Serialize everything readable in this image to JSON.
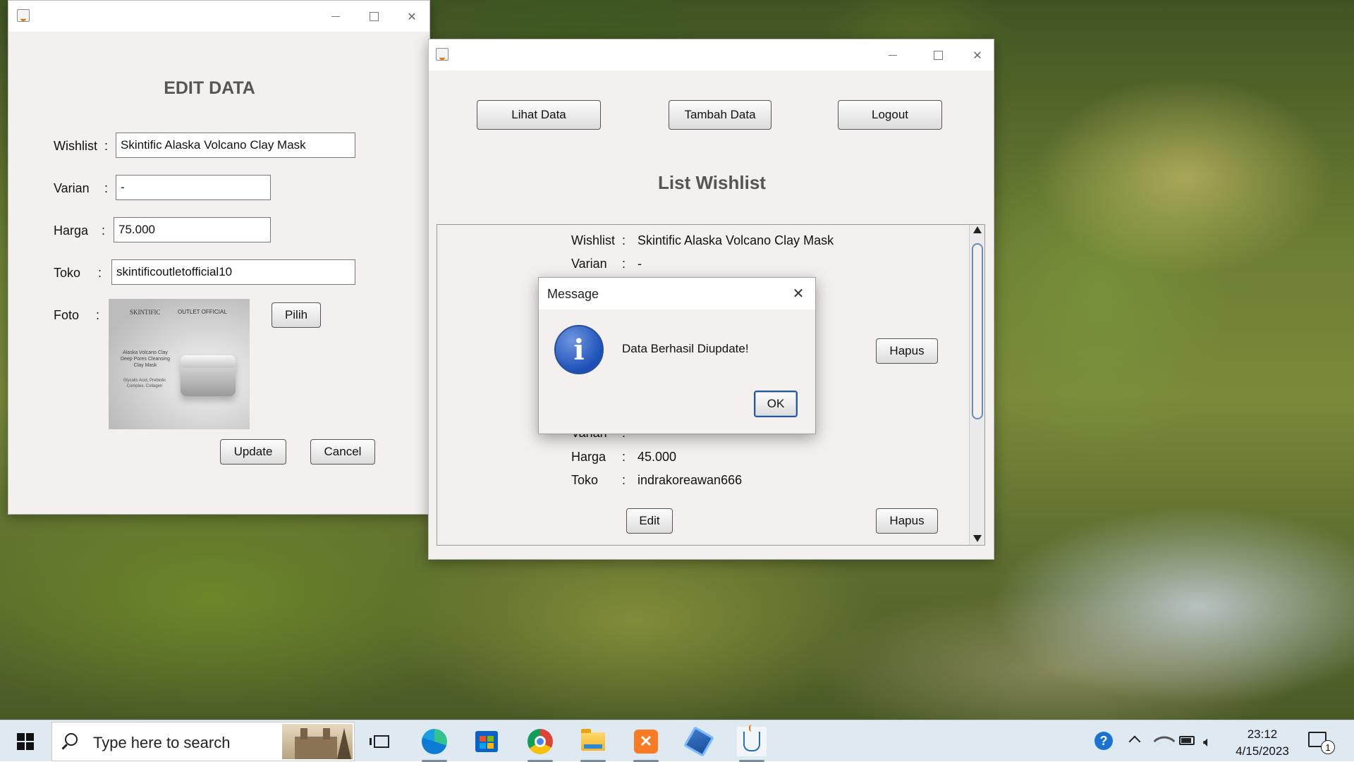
{
  "edit_window": {
    "heading": "EDIT DATA",
    "fields": [
      {
        "label": "Wishlist",
        "colon": ":",
        "value": "Skintific Alaska Volcano Clay Mask"
      },
      {
        "label": "Varian",
        "colon": ":",
        "value": "-"
      },
      {
        "label": "Harga",
        "colon": ":",
        "value": "75.000"
      },
      {
        "label": "Toko",
        "colon": ":",
        "value": "skintificoutletofficial10"
      }
    ],
    "foto": {
      "label": "Foto",
      "colon": ":",
      "image_text": {
        "brand": "SKINTIFIC",
        "tag": "OUTLET OFFICIAL",
        "product": "Alaska Volcano Clay Deep Pores Cleansing Clay Mask",
        "ingredients": "Glycolic Acid, Prebiotic Complex, Collagen"
      },
      "pick_button": "Pilih"
    },
    "update_button": "Update",
    "cancel_button": "Cancel"
  },
  "main_window": {
    "buttons": {
      "view": "Lihat Data",
      "add": "Tambah Data",
      "logout": "Logout"
    },
    "heading": "List Wishlist",
    "item1": {
      "wishlist_label": "Wishlist",
      "wishlist_value": "Skintific Alaska Volcano Clay Mask",
      "varian_label": "Varian",
      "varian_value": "-",
      "hapus": "Hapus"
    },
    "item2": {
      "varian_label": "Varian",
      "varian_value": "-",
      "harga_label": "Harga",
      "harga_value": "45.000",
      "toko_label": "Toko",
      "toko_value": "indrakoreawan666",
      "edit": "Edit",
      "hapus": "Hapus"
    },
    "colon": ":"
  },
  "dialog": {
    "title": "Message",
    "message": "Data Berhasil Diupdate!",
    "ok": "OK"
  },
  "taskbar": {
    "search_placeholder": "Type here to search",
    "time": "23:12",
    "date": "4/15/2023",
    "notification_count": "1",
    "pinned_apps": [
      "task-view-icon",
      "edge-icon",
      "store-icon",
      "chrome-icon",
      "file-explorer-icon",
      "xampp-icon",
      "virtualbox-icon",
      "java-icon"
    ],
    "colors": {
      "edge": "#0c7bd6",
      "chrome_red": "#db4437",
      "xampp": "#fb7a24",
      "store": "#0a62c7"
    }
  }
}
